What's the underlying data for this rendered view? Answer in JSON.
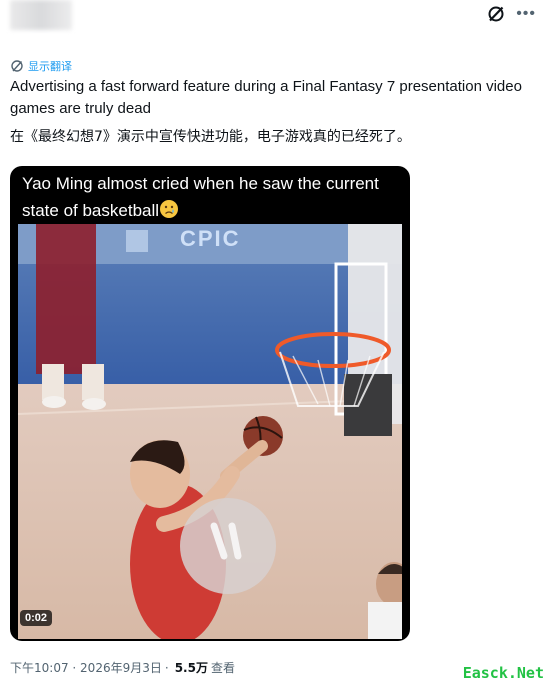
{
  "translate": {
    "label": "显示翻译"
  },
  "tweet": {
    "text": "Advertising a fast forward feature during a Final Fantasy 7 presentation video games are truly dead",
    "translation": "在《最终幻想7》演示中宣传快进功能，电子游戏真的已经死了。"
  },
  "media": {
    "caption": "Yao Ming almost cried when he saw the current state of basketball",
    "emoji": "crying-face-emoji",
    "backdrop_text": "CPIC",
    "duration": "0:02"
  },
  "meta": {
    "time": "下午10:07",
    "date": "2026年9月3日",
    "separator": "·",
    "views": "5.5万",
    "views_label": "查看"
  },
  "watermark": "Easck.Net",
  "colors": {
    "link": "#1d9bf0",
    "watermark": "#22c244"
  }
}
